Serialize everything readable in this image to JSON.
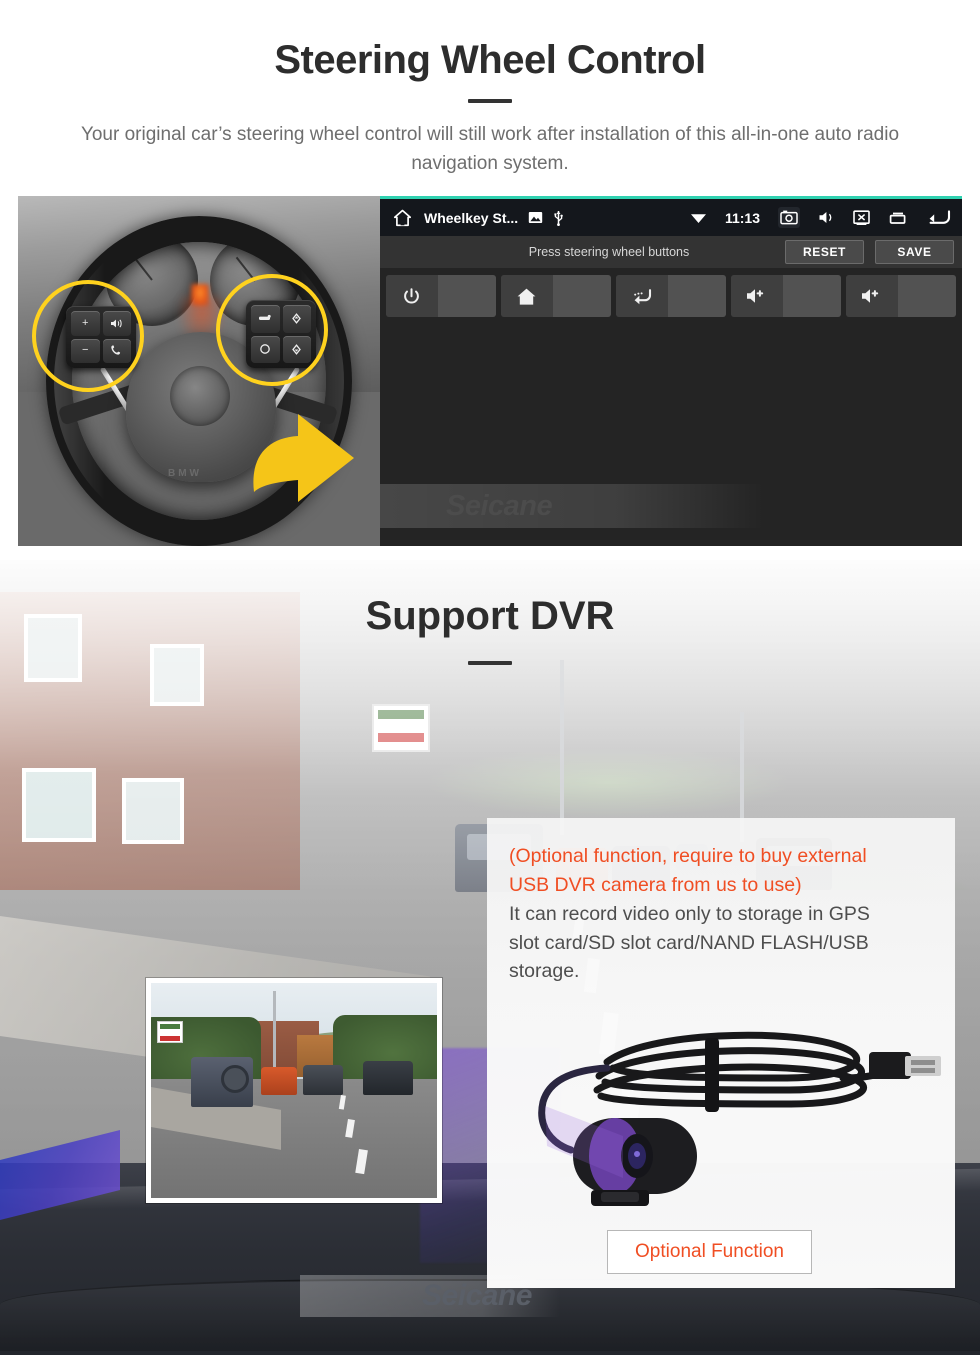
{
  "section1": {
    "title": "Steering Wheel Control",
    "subtitle": "Your original car’s steering wheel control will still work after installation of this all-in-one auto radio navigation system.",
    "photo": {
      "caption_alt": "Steering wheel with highlighted control pads",
      "wheel_badge": "BMW",
      "highlight_color": "#ffd21e",
      "arrow_color": "#f5c518",
      "left_pad_keys": [
        "+",
        "−",
        "voice",
        "call"
      ],
      "right_pad_keys": [
        "media",
        "up",
        "mode",
        "down"
      ]
    },
    "head_unit": {
      "accent_color": "#2fd1b0",
      "status_bar": {
        "home_icon": "home-icon",
        "app_title": "Wheelkey St...",
        "image_icon": "image-icon",
        "usb_icon": "usb-icon",
        "wifi_icon": "wifi-icon",
        "clock": "11:13",
        "screenshot_icon": "screenshot-camera-icon",
        "mute_icon": "speaker-mute-icon",
        "screen_off_icon": "screen-off-icon",
        "recents_icon": "recents-icon",
        "back_icon": "back-arrow-icon"
      },
      "action_bar": {
        "hint": "Press steering wheel buttons",
        "reset_label": "RESET",
        "save_label": "SAVE"
      },
      "keys": [
        {
          "icon": "power-icon",
          "label": ""
        },
        {
          "icon": "home-icon",
          "label": ""
        },
        {
          "icon": "back-icon",
          "label": ""
        },
        {
          "icon": "volume-up-icon",
          "label": ""
        },
        {
          "icon": "volume-up-icon",
          "label": ""
        }
      ],
      "watermark": "Seicane"
    }
  },
  "section2": {
    "title": "Support DVR",
    "preview": {
      "alt": "Dash camera video preview of a street"
    },
    "info": {
      "orange_line1": "(Optional function, require to buy external",
      "orange_line2": "USB DVR camera from us to use)",
      "grey_line1": "It can record video only to storage in GPS",
      "grey_line2": "slot card/SD slot card/NAND FLASH/USB",
      "grey_line3": "storage.",
      "orange_color": "#f04e23",
      "grey_color": "#4e4e4e"
    },
    "product": {
      "alt": "USB DVR dash camera with coiled cable"
    },
    "optional_button_label": "Optional Function",
    "watermark": "Seicane"
  }
}
